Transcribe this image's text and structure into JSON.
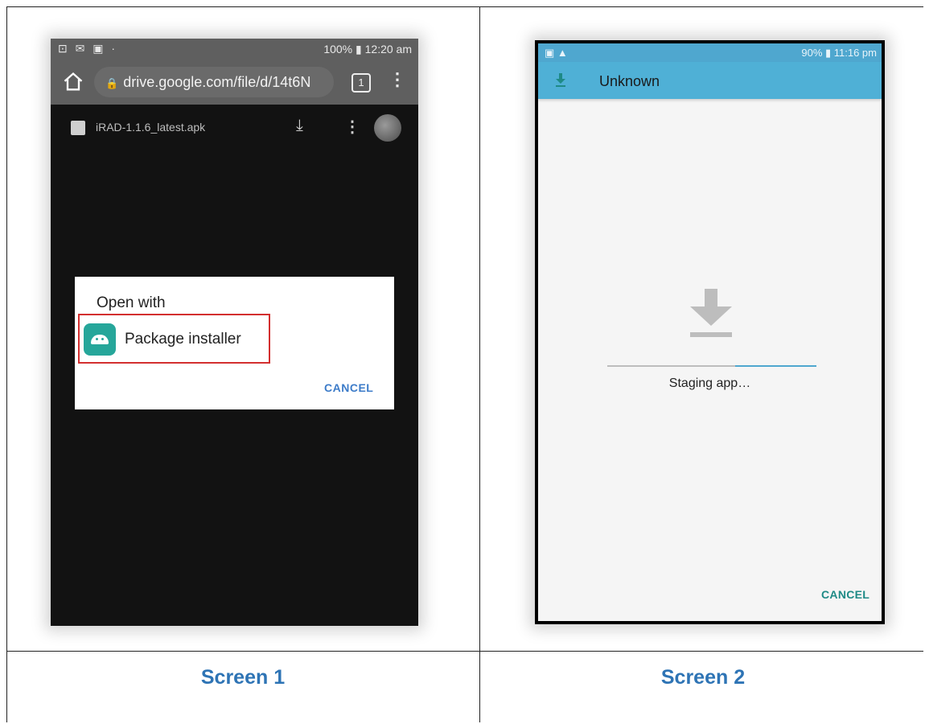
{
  "screen1": {
    "status": {
      "left_icons": "⊡ ✉ ▣ ·",
      "right_text": "100% ▮ 12:20 am"
    },
    "url": "drive.google.com/file/d/14t6N",
    "tab_count": "1",
    "file_name": "iRAD-1.1.6_latest.apk",
    "dialog": {
      "title": "Open with",
      "option_label": "Package installer",
      "cancel": "CANCEL"
    }
  },
  "screen2": {
    "status": {
      "right_text": "90% ▮ 11:16 pm"
    },
    "title": "Unknown",
    "progress_fraction": 0.39,
    "status_text": "Staging app…",
    "cancel": "CANCEL"
  },
  "captions": {
    "screen1": "Screen 1",
    "screen2": "Screen 2"
  },
  "colors": {
    "caption": "#2e74b5",
    "highlight": "#d32f2f",
    "appbar": "#4fb0d6",
    "accent": "#4fa7cf"
  }
}
